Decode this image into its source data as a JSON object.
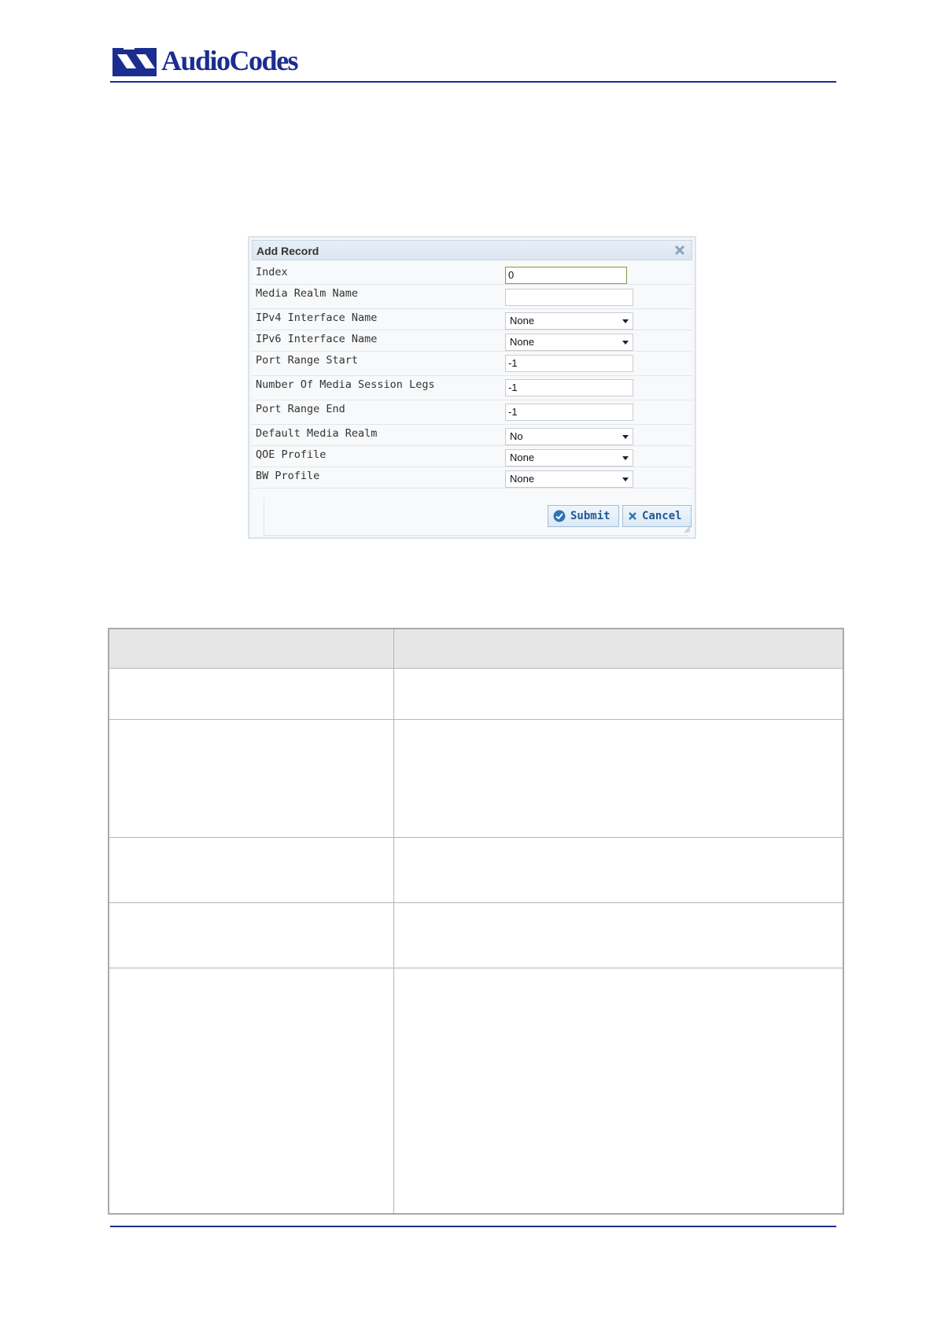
{
  "header": {
    "logo_text": "AudioCodes",
    "brand_color": "#1b2d8f"
  },
  "dialog": {
    "title": "Add Record",
    "fields": [
      {
        "label": "Index",
        "value": "0",
        "kind": "text"
      },
      {
        "label": "Media Realm Name",
        "value": "",
        "kind": "text"
      },
      {
        "label": "IPv4 Interface Name",
        "value": "None",
        "kind": "select"
      },
      {
        "label": "IPv6 Interface Name",
        "value": "None",
        "kind": "select"
      },
      {
        "label": "Port Range Start",
        "value": "-1",
        "kind": "text"
      },
      {
        "label": "Number Of Media Session Legs",
        "value": "-1",
        "kind": "text"
      },
      {
        "label": "Port Range End",
        "value": "-1",
        "kind": "text"
      },
      {
        "label": "Default Media Realm",
        "value": "No",
        "kind": "select"
      },
      {
        "label": "QOE Profile",
        "value": "None",
        "kind": "select"
      },
      {
        "label": "BW Profile",
        "value": "None",
        "kind": "select"
      }
    ],
    "submit_label": "Submit",
    "cancel_label": "Cancel"
  },
  "table": {
    "header_bg": "#e6e6e6",
    "rows": 5
  }
}
